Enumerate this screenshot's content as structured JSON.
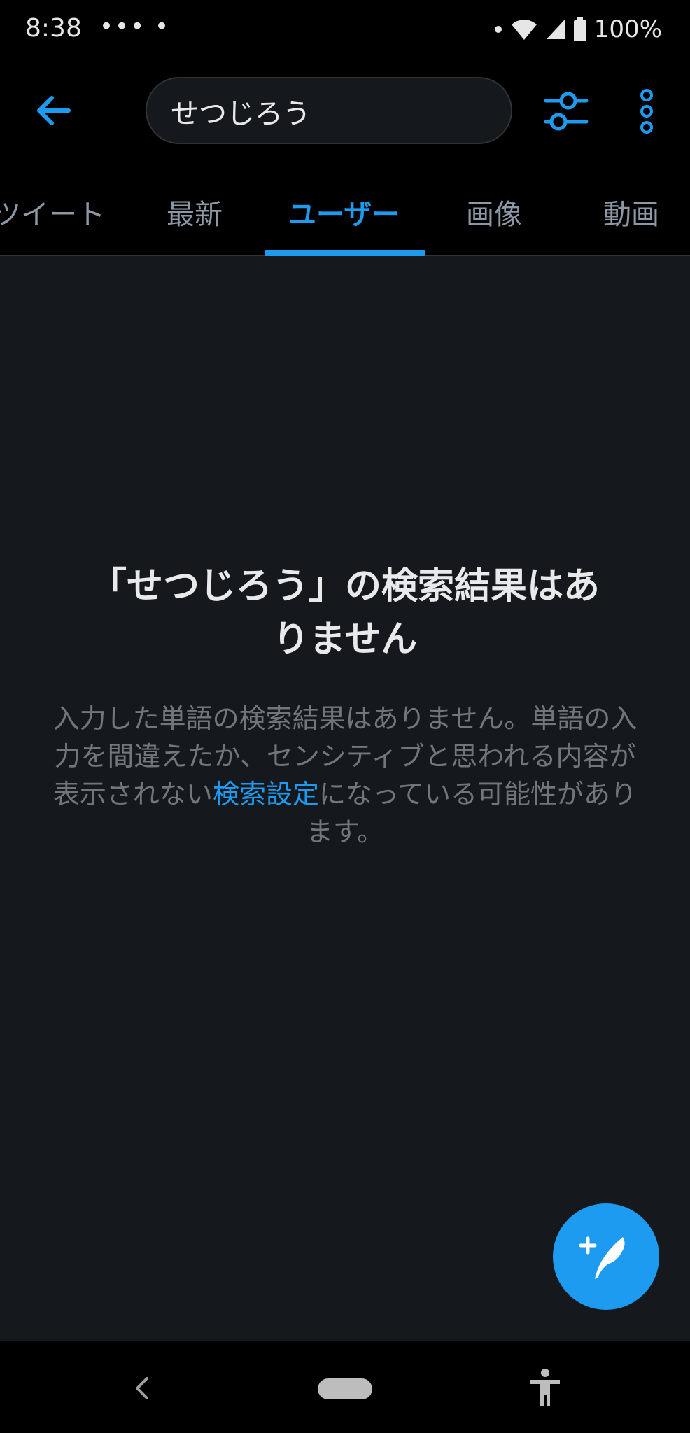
{
  "status_bar": {
    "time": "8:38",
    "dots": "••• •",
    "battery": "100%"
  },
  "search": {
    "query": "せつじろう"
  },
  "tabs": [
    {
      "label": "ツイート"
    },
    {
      "label": "最新"
    },
    {
      "label": "ユーザー",
      "active": true
    },
    {
      "label": "画像"
    },
    {
      "label": "動画"
    }
  ],
  "empty_state": {
    "title_line1": "「せつじろう」の検索結果はあ",
    "title_line2": "りません",
    "body_part1": "入力した単語の検索結果はありません。単語の入力を間違えたか、センシティブと思われる内容が表示されない",
    "body_link": "検索設定",
    "body_part2": "になっている可能性があります。"
  },
  "icons": {
    "back": "arrow-left-icon",
    "filter": "sliders-icon",
    "more": "more-vertical-icon",
    "compose": "compose-tweet-icon",
    "nav_back": "nav-back-icon",
    "accessibility": "accessibility-icon"
  },
  "colors": {
    "accent": "#1d9bf0",
    "background": "#15181c",
    "bar": "#000000"
  }
}
